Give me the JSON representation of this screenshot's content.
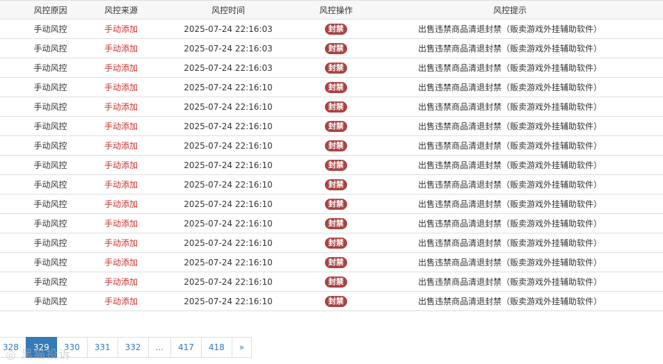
{
  "table": {
    "headers": [
      "风控原因",
      "风控来源",
      "风控时间",
      "风控操作",
      "风控提示"
    ],
    "rows": [
      {
        "reason": "手动风控",
        "source": "手动添加",
        "time": "2025-07-24 22:16:03",
        "action": "封禁",
        "tip": "出售违禁商品清退封禁（贩卖游戏外挂辅助软件）"
      },
      {
        "reason": "手动风控",
        "source": "手动添加",
        "time": "2025-07-24 22:16:03",
        "action": "封禁",
        "tip": "出售违禁商品清退封禁（贩卖游戏外挂辅助软件）"
      },
      {
        "reason": "手动风控",
        "source": "手动添加",
        "time": "2025-07-24 22:16:03",
        "action": "封禁",
        "tip": "出售违禁商品清退封禁（贩卖游戏外挂辅助软件）"
      },
      {
        "reason": "手动风控",
        "source": "手动添加",
        "time": "2025-07-24 22:16:10",
        "action": "封禁",
        "tip": "出售违禁商品清退封禁（贩卖游戏外挂辅助软件）"
      },
      {
        "reason": "手动风控",
        "source": "手动添加",
        "time": "2025-07-24 22:16:10",
        "action": "封禁",
        "tip": "出售违禁商品清退封禁（贩卖游戏外挂辅助软件）"
      },
      {
        "reason": "手动风控",
        "source": "手动添加",
        "time": "2025-07-24 22:16:10",
        "action": "封禁",
        "tip": "出售违禁商品清退封禁（贩卖游戏外挂辅助软件）"
      },
      {
        "reason": "手动风控",
        "source": "手动添加",
        "time": "2025-07-24 22:16:10",
        "action": "封禁",
        "tip": "出售违禁商品清退封禁（贩卖游戏外挂辅助软件）"
      },
      {
        "reason": "手动风控",
        "source": "手动添加",
        "time": "2025-07-24 22:16:10",
        "action": "封禁",
        "tip": "出售违禁商品清退封禁（贩卖游戏外挂辅助软件）"
      },
      {
        "reason": "手动风控",
        "source": "手动添加",
        "time": "2025-07-24 22:16:10",
        "action": "封禁",
        "tip": "出售违禁商品清退封禁（贩卖游戏外挂辅助软件）"
      },
      {
        "reason": "手动风控",
        "source": "手动添加",
        "time": "2025-07-24 22:16:10",
        "action": "封禁",
        "tip": "出售违禁商品清退封禁（贩卖游戏外挂辅助软件）"
      },
      {
        "reason": "手动风控",
        "source": "手动添加",
        "time": "2025-07-24 22:16:10",
        "action": "封禁",
        "tip": "出售违禁商品清退封禁（贩卖游戏外挂辅助软件）"
      },
      {
        "reason": "手动风控",
        "source": "手动添加",
        "time": "2025-07-24 22:16:10",
        "action": "封禁",
        "tip": "出售违禁商品清退封禁（贩卖游戏外挂辅助软件）"
      },
      {
        "reason": "手动风控",
        "source": "手动添加",
        "time": "2025-07-24 22:16:10",
        "action": "封禁",
        "tip": "出售违禁商品清退封禁（贩卖游戏外挂辅助软件）"
      },
      {
        "reason": "手动风控",
        "source": "手动添加",
        "time": "2025-07-24 22:16:10",
        "action": "封禁",
        "tip": "出售违禁商品清退封禁（贩卖游戏外挂辅助软件）"
      },
      {
        "reason": "手动风控",
        "source": "手动添加",
        "time": "2025-07-24 22:16:10",
        "action": "封禁",
        "tip": "出售违禁商品清退封禁（贩卖游戏外挂辅助软件）"
      }
    ]
  },
  "pagination": {
    "pages": [
      "328",
      "329",
      "330",
      "331",
      "332",
      "...",
      "417",
      "418",
      "»"
    ],
    "current": "329"
  },
  "watermark": "黑猫投诉",
  "colors": {
    "accent": "#337ab7",
    "source_text": "#c9302c",
    "badge": "#a94442",
    "border": "#dddddd"
  }
}
